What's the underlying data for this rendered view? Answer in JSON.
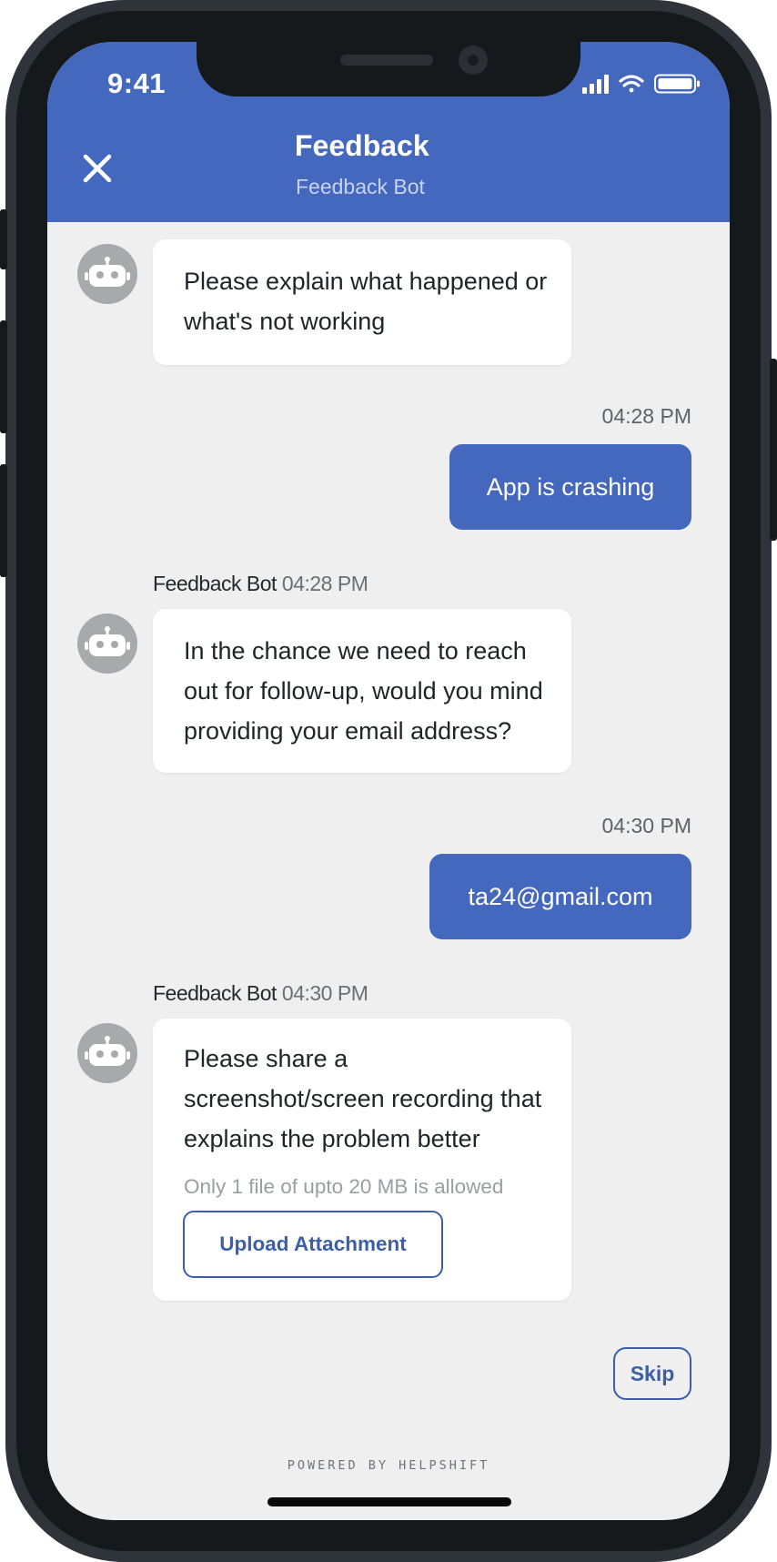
{
  "status_bar": {
    "time": "9:41"
  },
  "header": {
    "title": "Feedback",
    "subtitle": "Feedback Bot"
  },
  "messages": [
    {
      "from": "bot",
      "text": "Please explain what happened or\nwhat's not working"
    },
    {
      "from": "user",
      "time": "04:28 PM",
      "text": "App is crashing"
    },
    {
      "from": "bot",
      "sender": "Feedback Bot",
      "time": "04:28 PM",
      "text": "In the chance we need to reach\nout for follow-up, would you mind\nproviding your email address?"
    },
    {
      "from": "user",
      "time": "04:30 PM",
      "text": "ta24@gmail.com"
    },
    {
      "from": "bot",
      "sender": "Feedback Bot",
      "time": "04:30 PM",
      "text": "Please share a\nscreenshot/screen recording that\nexplains the problem better",
      "hint": "Only 1 file of upto 20 MB is allowed",
      "button": "Upload Attachment"
    }
  ],
  "skip_label": "Skip",
  "footer": "POWERED BY HELPSHIFT",
  "colors": {
    "primary": "#4468be",
    "background": "#efeff0",
    "bubble": "#ffffff"
  }
}
